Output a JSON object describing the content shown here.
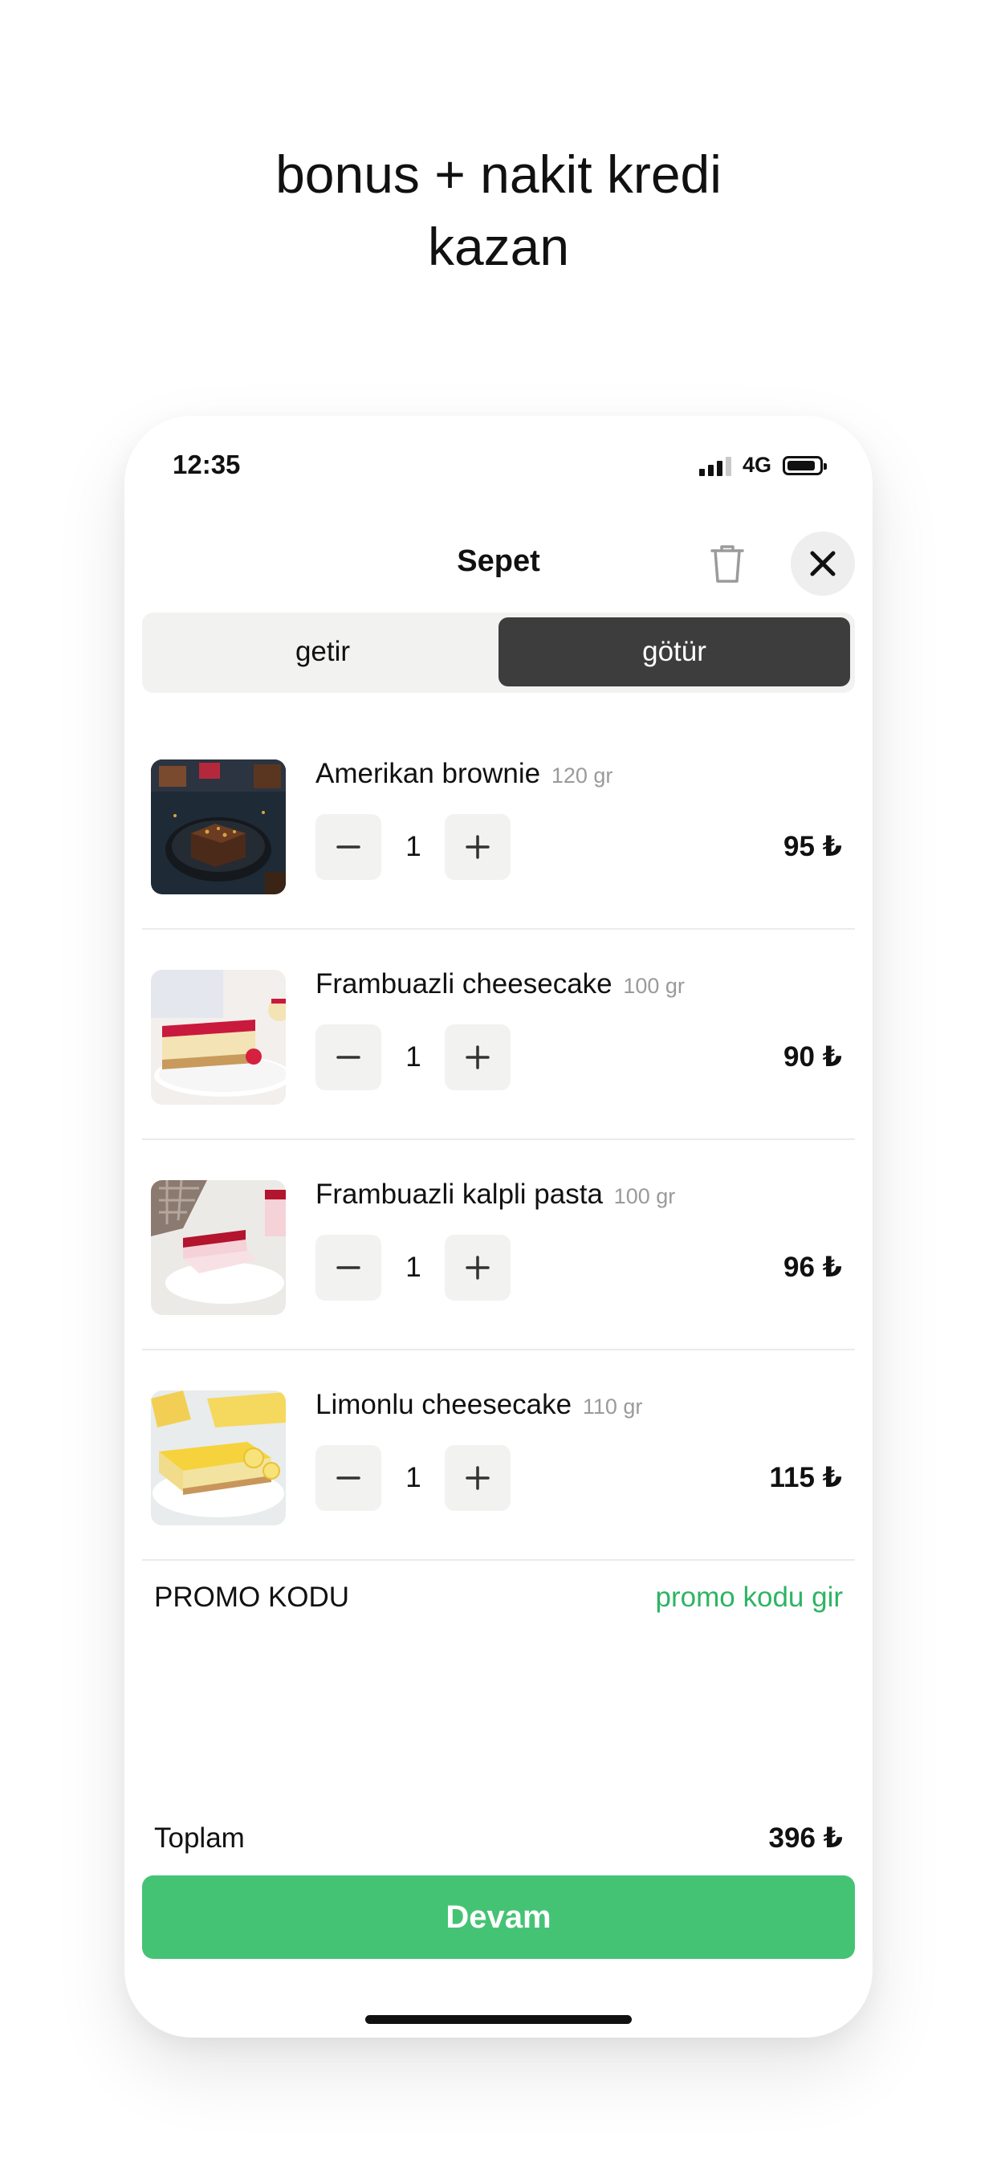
{
  "headline": {
    "line1": "bonus + nakit kredi",
    "line2": "kazan"
  },
  "status_bar": {
    "time": "12:35",
    "network": "4G"
  },
  "header": {
    "title": "Sepet"
  },
  "segmented": {
    "left": "getir",
    "right": "götür",
    "selected": "götür"
  },
  "items": [
    {
      "name": "Amerikan brownie",
      "weight": "120 gr",
      "quantity": "1",
      "price": "95 ₺"
    },
    {
      "name": "Frambuazli cheesecake",
      "weight": "100 gr",
      "quantity": "1",
      "price": "90 ₺"
    },
    {
      "name": "Frambuazli kalpli pasta",
      "weight": "100 gr",
      "quantity": "1",
      "price": "96 ₺"
    },
    {
      "name": "Limonlu cheesecake",
      "weight": "110 gr",
      "quantity": "1",
      "price": "115 ₺"
    }
  ],
  "promo": {
    "label": "PROMO KODU",
    "link": "promo kodu gir"
  },
  "total": {
    "label": "Toplam",
    "value": "396 ₺"
  },
  "cta": {
    "label": "Devam"
  },
  "colors": {
    "accent": "#45c374",
    "link": "#2db463",
    "selected_segment": "#3d3d3d"
  },
  "icons": [
    "signal-icon",
    "battery-icon",
    "trash-icon",
    "close-icon",
    "minus-icon",
    "plus-icon"
  ]
}
